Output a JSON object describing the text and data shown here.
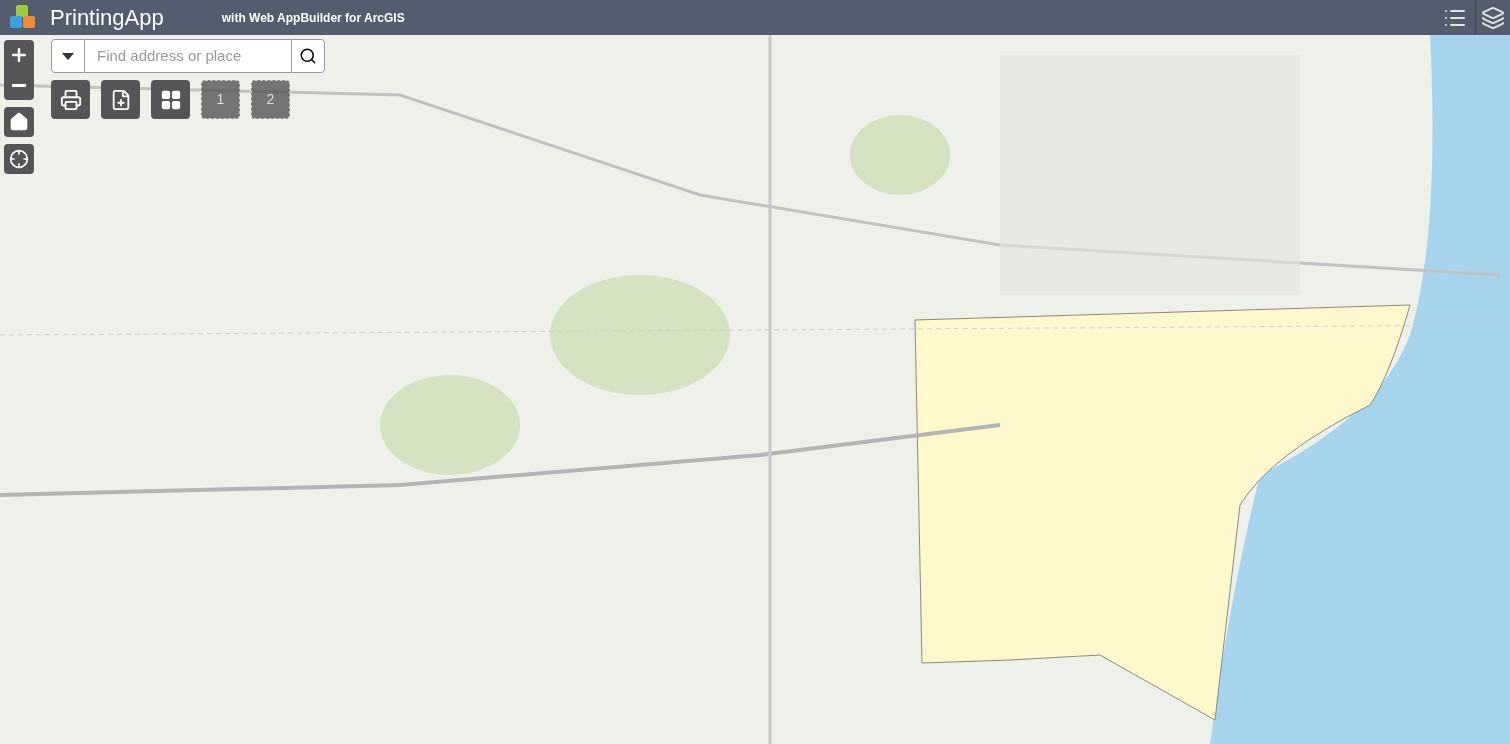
{
  "header": {
    "title": "PrintingApp",
    "subtitle": "with Web AppBuilder for ArcGIS"
  },
  "search": {
    "placeholder": "Find address or place"
  },
  "widgets": [
    {
      "kind": "print"
    },
    {
      "kind": "add-data"
    },
    {
      "kind": "basemap"
    }
  ],
  "placeholders": [
    {
      "label": "1"
    },
    {
      "label": "2"
    }
  ]
}
